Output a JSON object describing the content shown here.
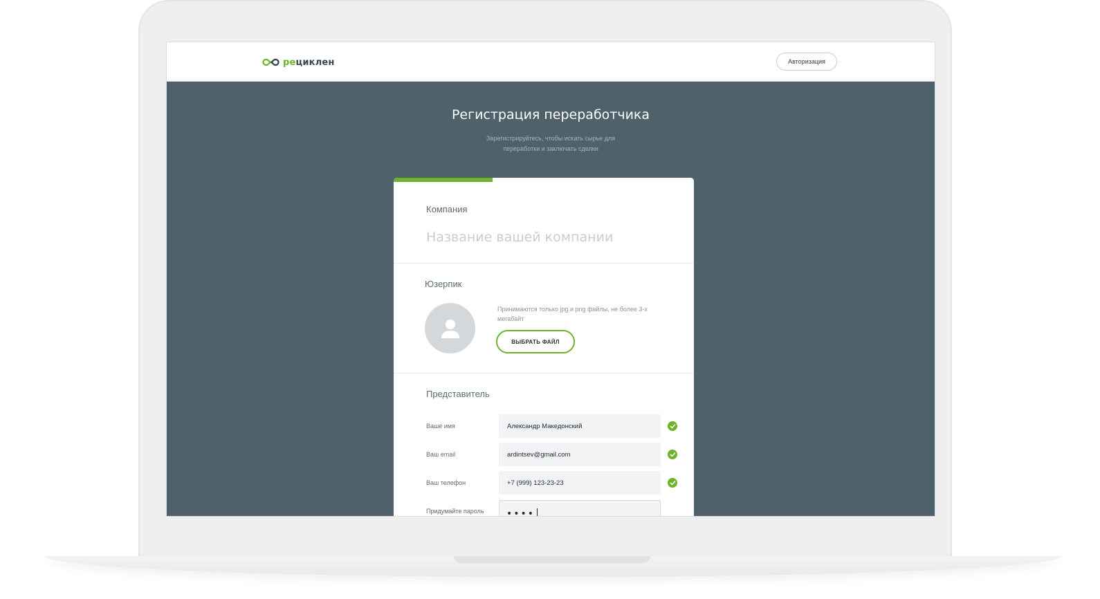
{
  "app": {
    "logo_prefix": "ре",
    "logo_suffix": "циклен",
    "logo_icon": "infinity-icon",
    "accent_color": "#6fb22b",
    "background_color": "#4f616b"
  },
  "header": {
    "auth_label": "Авторизация"
  },
  "hero": {
    "title": "Регистрация переработчика",
    "subtitle": "Зарегистрируйтесь, чтобы искать сырье для переработки и заключать сделки"
  },
  "form": {
    "progress": 0.33,
    "company": {
      "label": "Компания",
      "placeholder": "Название вашей компании",
      "value": ""
    },
    "userpic": {
      "label": "Юзерпик",
      "hint": "Принимаются только jpg и png файлы, не более 3-х мегабайт",
      "button_label": "ВЫБРАТЬ ФАЙЛ",
      "avatar_icon": "user-placeholder-icon"
    },
    "representative": {
      "label": "Представитель",
      "name_label": "Ваше имя",
      "name_value": "Александр Македонский",
      "email_label": "Ваш email",
      "email_value": "ardintsev@gmail.com",
      "phone_label": "Ваш телефон",
      "phone_value": "+7 (999) 123-23-23",
      "password_label": "Придумайте пароль",
      "password_mask": "••••",
      "valid_icon": "check-circle-icon"
    }
  }
}
